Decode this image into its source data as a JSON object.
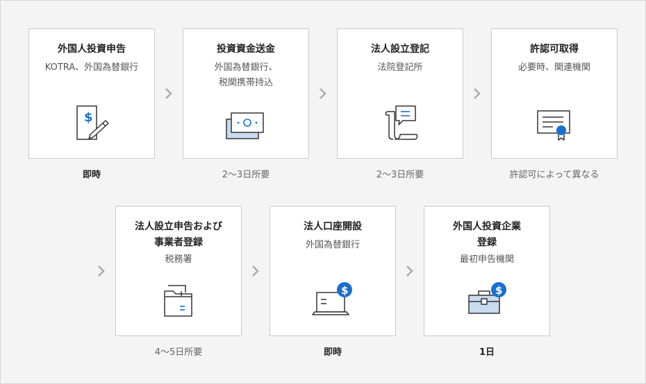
{
  "steps": [
    {
      "title": "外国人投資申告",
      "sub": "KOTRA、外国為替銀行",
      "duration": "即時",
      "icon": "document-dollar-pen-icon"
    },
    {
      "title": "投資資金送金",
      "sub": "外国為替銀行、\n税関携帯持込",
      "duration": "2〜3日所要",
      "icon": "banknotes-icon"
    },
    {
      "title": "法人設立登記",
      "sub": "法院登記所",
      "duration": "2〜3日所要",
      "icon": "scroll-speech-icon"
    },
    {
      "title": "許認可取得",
      "sub": "必要時、関連機関",
      "duration": "許認可によって異なる",
      "icon": "certificate-icon"
    },
    {
      "title": "法人設立申告および\n事業者登録",
      "sub": "税務署",
      "duration": "4〜5日所要",
      "icon": "folder-icon"
    },
    {
      "title": "法人口座開設",
      "sub": "外国為替銀行",
      "duration": "即時",
      "icon": "laptop-dollar-icon"
    },
    {
      "title": "外国人投資企業\n登録",
      "sub": "最初申告機関",
      "duration": "1日",
      "icon": "briefcase-dollar-icon"
    }
  ],
  "colors": {
    "accent": "#1a6fd1",
    "iconFill": "#c8dbef",
    "stroke": "#333333"
  }
}
